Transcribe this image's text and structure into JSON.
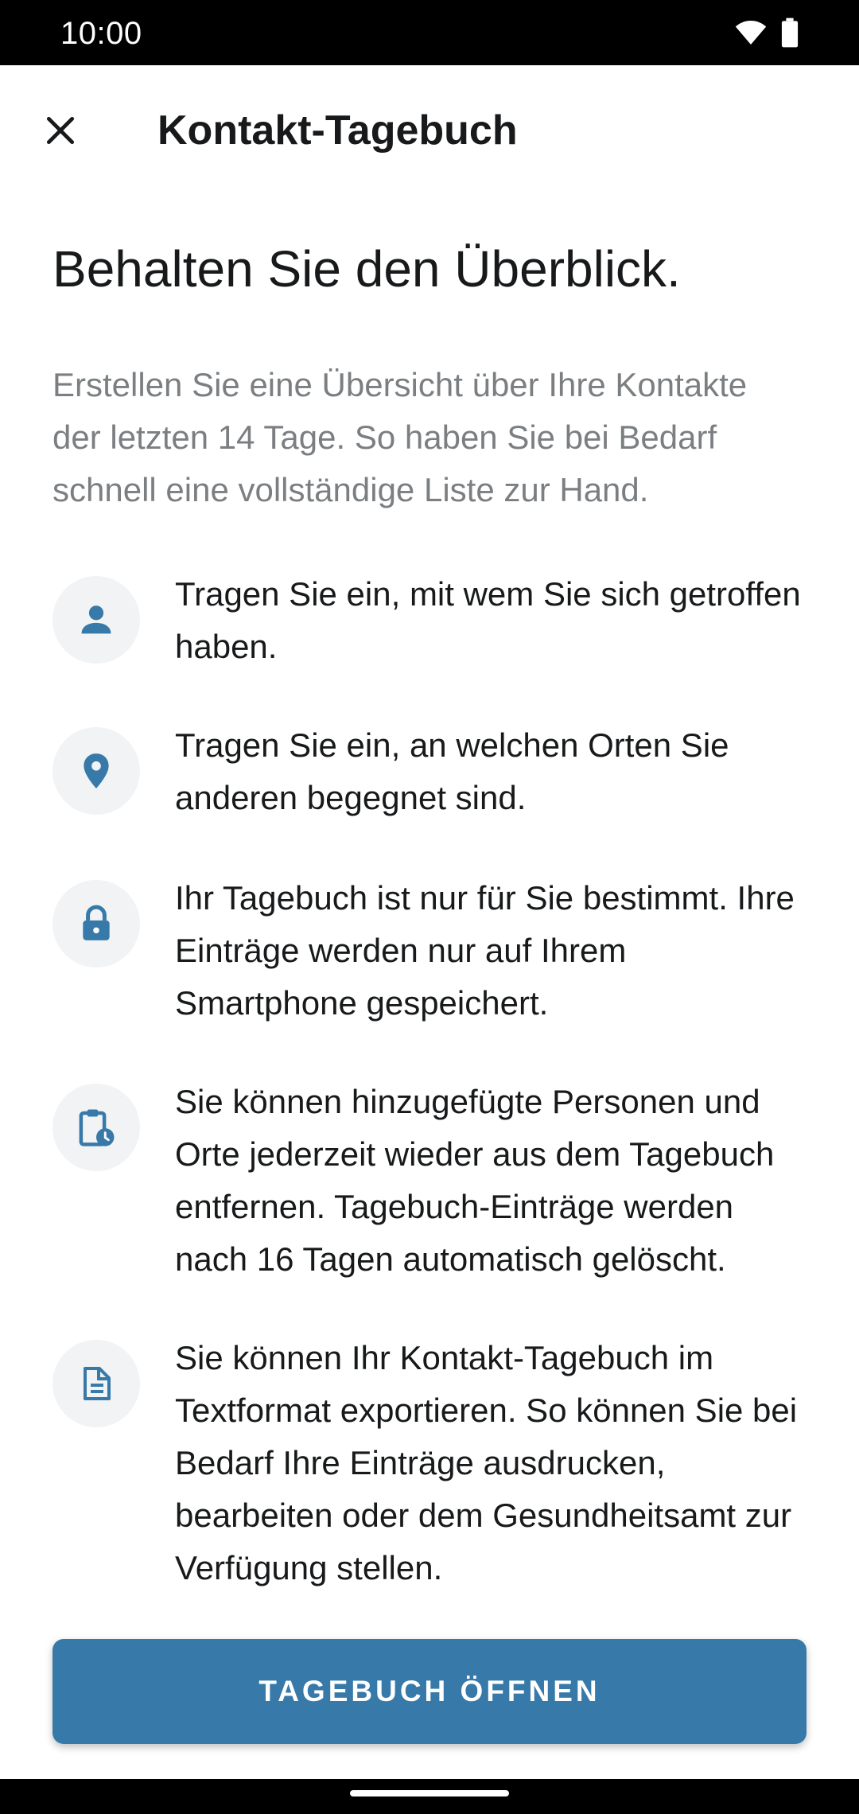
{
  "status_bar": {
    "time": "10:00",
    "icons": [
      "wifi-icon",
      "battery-icon"
    ]
  },
  "app_bar": {
    "title": "Kontakt-Tagebuch",
    "close_icon": "close-icon"
  },
  "headline": "Behalten Sie den Überblick.",
  "subtitle": "Erstellen Sie eine Übersicht über Ihre Kontakte der letzten 14 Tage. So haben Sie bei Bedarf schnell eine vollständige Liste zur Hand.",
  "items": [
    {
      "icon": "person-icon",
      "text": "Tragen Sie ein, mit wem Sie sich getroffen haben."
    },
    {
      "icon": "location-pin-icon",
      "text": "Tragen Sie ein, an welchen Orten Sie anderen begegnet sind."
    },
    {
      "icon": "lock-icon",
      "text": "Ihr Tagebuch ist nur für Sie bestimmt. Ihre Einträge werden nur auf Ihrem Smartphone gespeichert."
    },
    {
      "icon": "clipboard-clock-icon",
      "text": "Sie können hinzugefügte Personen und Orte jederzeit wieder aus dem Tagebuch entfernen. Tagebuch-Einträge werden nach 16 Tagen automatisch gelöscht."
    },
    {
      "icon": "document-icon",
      "text": "Sie können Ihr Kontakt-Tagebuch im Textformat exportieren. So können Sie bei Bedarf Ihre Einträge ausdrucken, bearbeiten oder dem Gesundheitsamt zur Verfügung stellen."
    }
  ],
  "button": {
    "label": "TAGEBUCH ÖFFNEN"
  },
  "colors": {
    "accent": "#3779a8",
    "icon_bg": "#f2f3f4",
    "subtitle": "#7b7f82",
    "text": "#17191a"
  }
}
